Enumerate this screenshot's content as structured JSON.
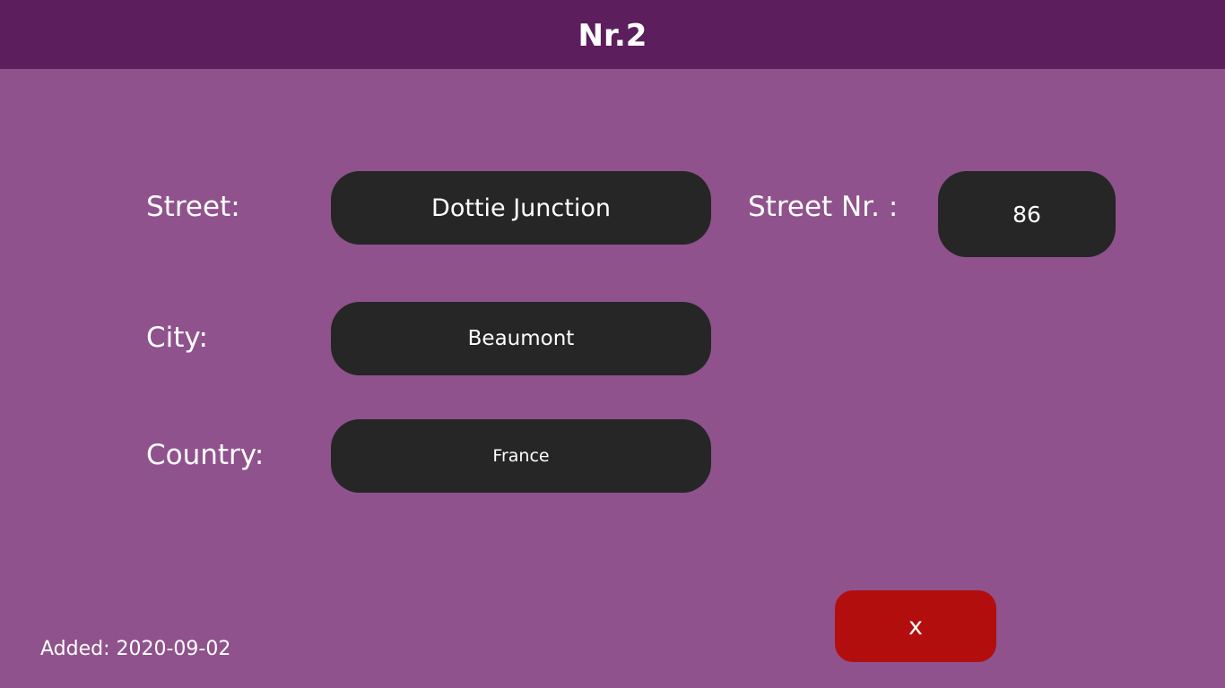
{
  "header": {
    "title": "Nr.2"
  },
  "form": {
    "street": {
      "label": "Street:",
      "value": "Dottie Junction"
    },
    "street_nr": {
      "label": "Street Nr. :",
      "value": "86"
    },
    "city": {
      "label": "City:",
      "value": "Beaumont"
    },
    "country": {
      "label": "Country:",
      "value": "France"
    }
  },
  "actions": {
    "close_label": "x"
  },
  "footer": {
    "added_text": "Added: 2020-09-02"
  },
  "colors": {
    "background": "#8f528d",
    "header": "#5c1e5c",
    "field": "#262626",
    "close_button": "#b20e0e",
    "text": "#ffffff"
  }
}
